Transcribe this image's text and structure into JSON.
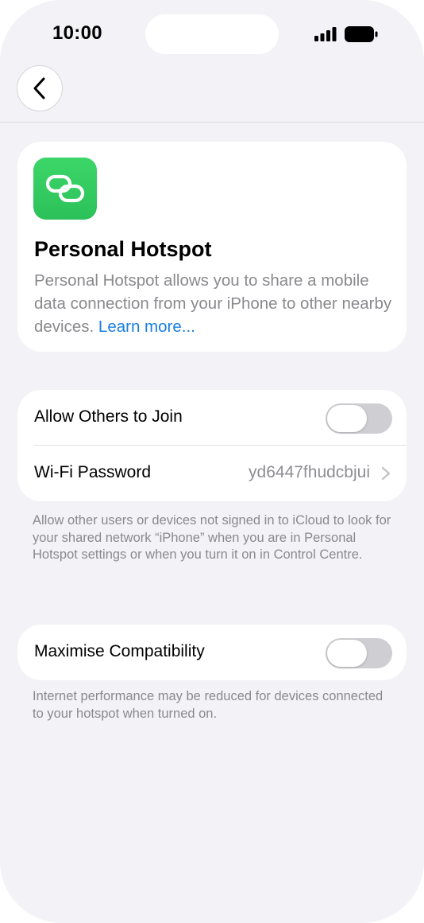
{
  "status_bar": {
    "time": "10:00"
  },
  "nav": {
    "back_icon": "chevron-left-icon"
  },
  "info_card": {
    "icon": "link-rings-icon",
    "title": "Personal Hotspot",
    "description": "Personal Hotspot allows you to share a mobile data connection from your iPhone to other nearby devices.",
    "learn_more": "Learn more..."
  },
  "settings": {
    "allow_others": {
      "label": "Allow Others to Join",
      "enabled": false
    },
    "wifi_password": {
      "label": "Wi-Fi Password",
      "value": "yd6447fhudcbjui"
    },
    "footnote": "Allow other users or devices not signed in to iCloud to look for your shared network “iPhone” when you are in Personal Hotspot settings or when you turn it on in Control Centre."
  },
  "compatibility": {
    "label": "Maximise Compatibility",
    "enabled": false,
    "footnote": "Internet performance may be reduced for devices connected to your hotspot when turned on."
  },
  "colors": {
    "background": "#f2f2f7",
    "accent_link": "#1a7ee0",
    "app_icon_green": "#34c759",
    "toggle_off": "#cfcfd3"
  }
}
